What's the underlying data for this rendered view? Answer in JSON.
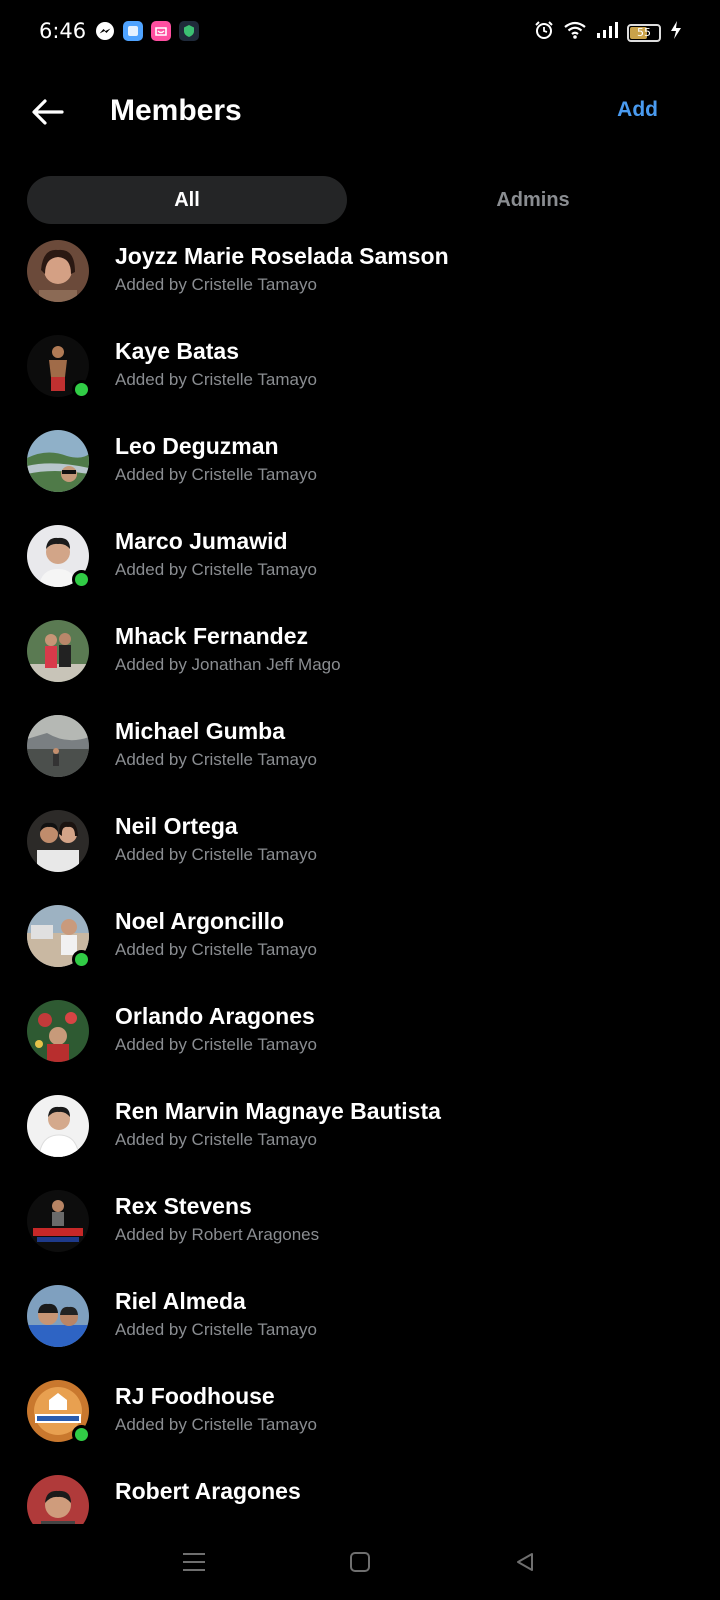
{
  "status_bar": {
    "time": "6:46",
    "battery_level": "55",
    "notification_icons": [
      "messenger-icon",
      "blue-app-icon",
      "pink-app-icon",
      "shield-app-icon"
    ],
    "system_icons": [
      "alarm-icon",
      "wifi-icon",
      "signal-icon",
      "battery-icon",
      "charging-icon"
    ]
  },
  "header": {
    "title": "Members",
    "add_label": "Add"
  },
  "tabs": {
    "all_label": "All",
    "admins_label": "Admins",
    "active": "All"
  },
  "members": [
    {
      "name": "Joyzz Marie Roselada Samson",
      "added_by": "Added by Cristelle Tamayo",
      "online": false
    },
    {
      "name": "Kaye Batas",
      "added_by": "Added by Cristelle Tamayo",
      "online": true
    },
    {
      "name": "Leo Deguzman",
      "added_by": "Added by Cristelle Tamayo",
      "online": false
    },
    {
      "name": "Marco Jumawid",
      "added_by": "Added by Cristelle Tamayo",
      "online": true
    },
    {
      "name": "Mhack Fernandez",
      "added_by": "Added by Jonathan Jeff Mago",
      "online": false
    },
    {
      "name": "Michael Gumba",
      "added_by": "Added by Cristelle Tamayo",
      "online": false
    },
    {
      "name": "Neil Ortega",
      "added_by": "Added by Cristelle Tamayo",
      "online": false
    },
    {
      "name": "Noel Argoncillo",
      "added_by": "Added by Cristelle Tamayo",
      "online": true
    },
    {
      "name": "Orlando Aragones",
      "added_by": "Added by Cristelle Tamayo",
      "online": false
    },
    {
      "name": "Ren Marvin Magnaye Bautista",
      "added_by": "Added by Cristelle Tamayo",
      "online": false
    },
    {
      "name": "Rex Stevens",
      "added_by": "Added by Robert Aragones",
      "online": false
    },
    {
      "name": "Riel Almeda",
      "added_by": "Added by Cristelle Tamayo",
      "online": false
    },
    {
      "name": "RJ Foodhouse",
      "added_by": "Added by Cristelle Tamayo",
      "online": true
    },
    {
      "name": "Robert Aragones",
      "added_by": "",
      "online": false
    }
  ],
  "colors": {
    "accent": "#4a9bf0",
    "online": "#31cc46",
    "background": "#000000",
    "tab_active_bg": "#242526",
    "secondary_text": "#8a8d91"
  },
  "nav_bar": {
    "icons": [
      "menu-icon",
      "home-square-icon",
      "back-triangle-icon"
    ]
  }
}
